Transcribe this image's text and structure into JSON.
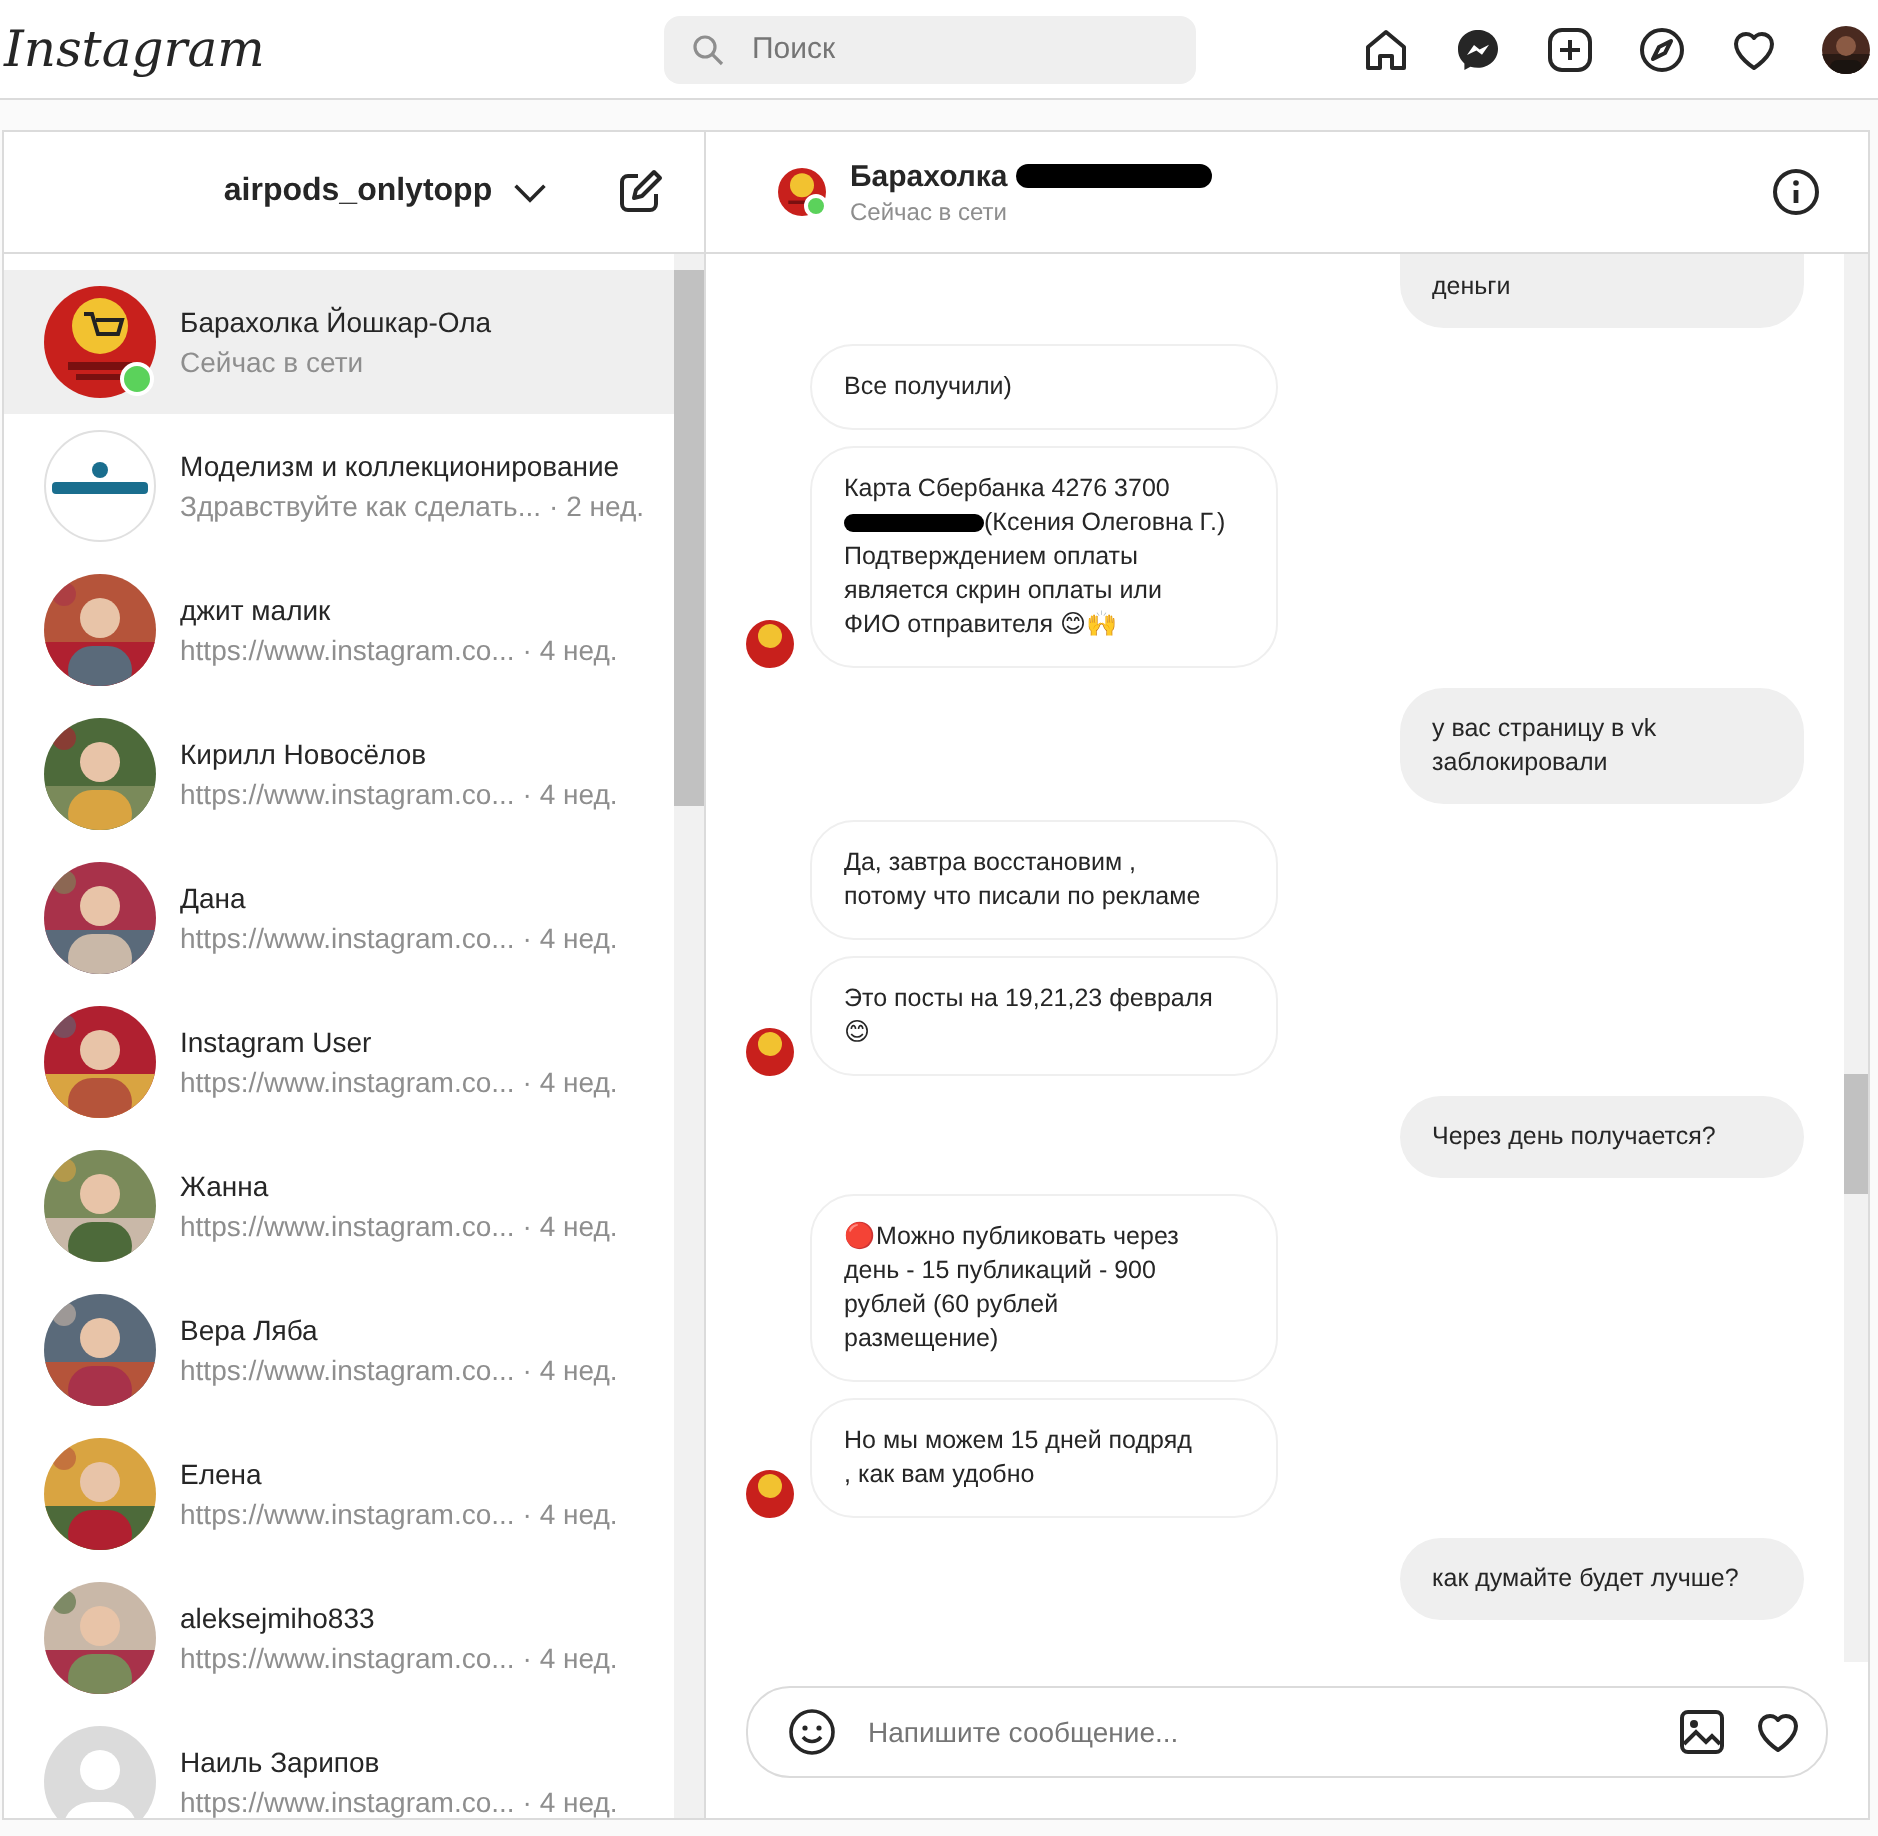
{
  "topbar": {
    "logo": "Instagram",
    "search": {
      "placeholder": "Поиск"
    }
  },
  "inbox": {
    "account": "airpods_onlytopp",
    "conversations": [
      {
        "name": "Барахолка Йошкар-Ола",
        "preview": "Сейчас в сети",
        "selected": true,
        "online": true
      },
      {
        "name": "Моделизм и коллекционирование",
        "preview": "Здравствуйте как сделать...",
        "time": "· 2 нед.",
        "selected": false,
        "online": false
      },
      {
        "name": "джит малик",
        "preview": "https://www.instagram.co...",
        "time": "· 4 нед.",
        "selected": false,
        "online": false
      },
      {
        "name": "Кирилл Новосёлов",
        "preview": "https://www.instagram.co...",
        "time": "· 4 нед.",
        "selected": false,
        "online": false
      },
      {
        "name": "Дана",
        "preview": "https://www.instagram.co...",
        "time": "· 4 нед.",
        "selected": false,
        "online": false
      },
      {
        "name": "Instagram User",
        "preview": "https://www.instagram.co...",
        "time": "· 4 нед.",
        "selected": false,
        "online": false
      },
      {
        "name": "Жанна",
        "preview": "https://www.instagram.co...",
        "time": "· 4 нед.",
        "selected": false,
        "online": false
      },
      {
        "name": "Вера Ляба",
        "preview": "https://www.instagram.co...",
        "time": "· 4 нед.",
        "selected": false,
        "online": false
      },
      {
        "name": "Елена",
        "preview": "https://www.instagram.co...",
        "time": "· 4 нед.",
        "selected": false,
        "online": false
      },
      {
        "name": "aleksejmiho833",
        "preview": "https://www.instagram.co...",
        "time": "· 4 нед.",
        "selected": false,
        "online": false
      },
      {
        "name": "Наиль Зарипов",
        "preview": "https://www.instagram.co...",
        "time": "· 4 нед.",
        "selected": false,
        "online": false
      }
    ]
  },
  "chat": {
    "title": "Барахолка",
    "title_redacted": true,
    "status": "Сейчас в сети",
    "online": true,
    "messages": [
      {
        "kind": "outgoing",
        "avatar": false,
        "lines": [
          [
            {
              "kind": "text",
              "text": "деньги"
            }
          ]
        ]
      },
      {
        "kind": "incoming",
        "avatar": false,
        "lines": [
          [
            {
              "kind": "text",
              "text": "Все получили)"
            }
          ]
        ]
      },
      {
        "kind": "incoming",
        "avatar": true,
        "lines": [
          [
            {
              "kind": "text",
              "text": "Карта Сбербанка 4276 3700"
            }
          ],
          [
            {
              "kind": "redaction"
            },
            {
              "kind": "text",
              "text": "(Ксения Олеговна Г.)"
            }
          ],
          [
            {
              "kind": "text",
              "text": "Подтверждением оплаты"
            }
          ],
          [
            {
              "kind": "text",
              "text": "является скрин оплаты или"
            }
          ],
          [
            {
              "kind": "text",
              "text": "ФИО отправителя 😊🙌"
            }
          ]
        ]
      },
      {
        "kind": "outgoing",
        "avatar": false,
        "lines": [
          [
            {
              "kind": "text",
              "text": "у вас страницу в vk"
            }
          ],
          [
            {
              "kind": "text",
              "text": "заблокировали"
            }
          ]
        ]
      },
      {
        "kind": "incoming",
        "avatar": false,
        "lines": [
          [
            {
              "kind": "text",
              "text": "Да, завтра восстановим ,"
            }
          ],
          [
            {
              "kind": "text",
              "text": "потому что писали по рекламе"
            }
          ]
        ]
      },
      {
        "kind": "incoming",
        "avatar": true,
        "lines": [
          [
            {
              "kind": "text",
              "text": "Это посты на 19,21,23 февраля"
            }
          ],
          [
            {
              "kind": "text",
              "text": "😊"
            }
          ]
        ]
      },
      {
        "kind": "outgoing",
        "avatar": false,
        "lines": [
          [
            {
              "kind": "text",
              "text": "Через день получается?"
            }
          ]
        ]
      },
      {
        "kind": "incoming",
        "avatar": false,
        "lines": [
          [
            {
              "kind": "text",
              "text": "🔴Можно публиковать через"
            }
          ],
          [
            {
              "kind": "text",
              "text": "день - 15 публикаций - 900"
            }
          ],
          [
            {
              "kind": "text",
              "text": "рублей (60 рублей"
            }
          ],
          [
            {
              "kind": "text",
              "text": "размещение)"
            }
          ]
        ]
      },
      {
        "kind": "incoming",
        "avatar": true,
        "lines": [
          [
            {
              "kind": "text",
              "text": "Но мы можем 15 дней подряд"
            }
          ],
          [
            {
              "kind": "text",
              "text": ", как вам удобно"
            }
          ]
        ]
      },
      {
        "kind": "outgoing",
        "avatar": false,
        "lines": [
          [
            {
              "kind": "text",
              "text": "как думайте будет лучше?"
            }
          ]
        ]
      }
    ],
    "composer": {
      "placeholder": "Напишите сообщение..."
    }
  }
}
